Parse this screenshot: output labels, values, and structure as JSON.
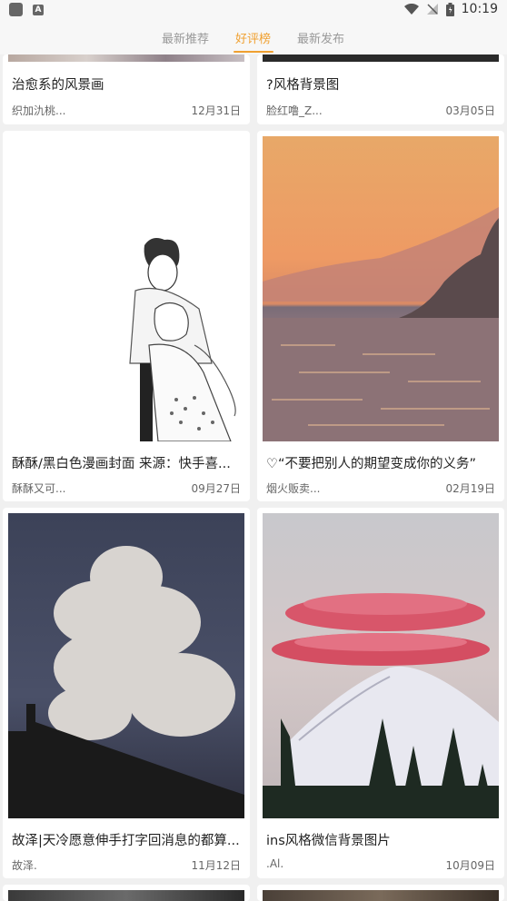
{
  "status": {
    "time": "10:19",
    "icons": [
      "app-icon",
      "a-notification-icon",
      "wifi-icon",
      "signal-off-icon",
      "battery-icon"
    ]
  },
  "tabs": [
    {
      "label": "最新推荐",
      "active": false
    },
    {
      "label": "好评榜",
      "active": true
    },
    {
      "label": "最新发布",
      "active": false
    }
  ],
  "cards": [
    {
      "title": "治愈系的风景画",
      "author": "织加氿桃...",
      "date": "12月31日"
    },
    {
      "title": "?风格背景图",
      "author": "脸红噜_Z...",
      "date": "03月05日"
    },
    {
      "title": "酥酥/黑白色漫画封面 来源：快手喜...",
      "author": "酥酥又可...",
      "date": "09月27日"
    },
    {
      "title": "♡“不要把别人的期望变成你的义务”",
      "author": "烟火贩卖...",
      "date": "02月19日"
    },
    {
      "title": "故泽|天冷愿意伸手打字回消息的都算...",
      "author": "故泽.",
      "date": "11月12日"
    },
    {
      "title": "ins风格微信背景图片",
      "author": ".Al.",
      "date": "10月09日"
    }
  ],
  "colors": {
    "accent": "#f0a030",
    "background": "#f0f0f0"
  }
}
